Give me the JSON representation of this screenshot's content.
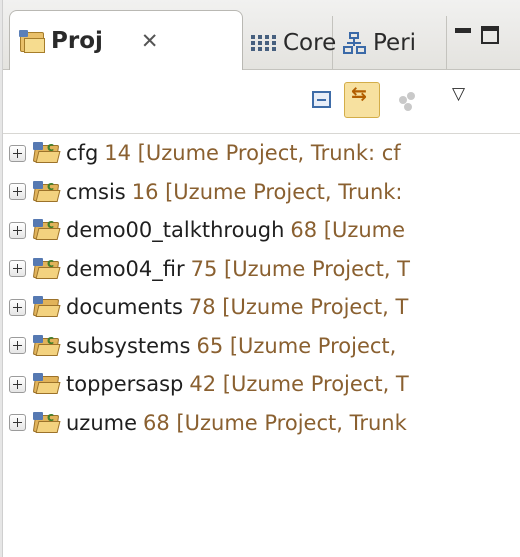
{
  "tabs": [
    {
      "label": "Proj",
      "close": "✕",
      "active": true
    },
    {
      "label": "Core",
      "active": false
    },
    {
      "label": "Peri",
      "active": false
    }
  ],
  "toolbar": {
    "buttons": [
      "collapse-all",
      "link-with-editor",
      "filter",
      "view-menu"
    ],
    "menu_glyph": "▽"
  },
  "tree": {
    "items": [
      {
        "name": "cfg",
        "decoration": "14 [Uzume Project, Trunk: cf",
        "icon": "project-folder-with-c-icon"
      },
      {
        "name": "cmsis",
        "decoration": "16 [Uzume Project, Trunk:",
        "icon": "project-folder-with-c-icon"
      },
      {
        "name": "demo00_talkthrough",
        "decoration": "68 [Uzume",
        "icon": "project-folder-with-c-icon"
      },
      {
        "name": "demo04_fir",
        "decoration": "75 [Uzume Project, T",
        "icon": "project-folder-with-c-icon"
      },
      {
        "name": "documents",
        "decoration": "78 [Uzume Project, T",
        "icon": "project-folder-icon"
      },
      {
        "name": "subsystems",
        "decoration": "65 [Uzume Project,",
        "icon": "project-folder-with-c-icon"
      },
      {
        "name": "toppersasp",
        "decoration": "42 [Uzume Project, T",
        "icon": "project-folder-icon"
      },
      {
        "name": "uzume",
        "decoration": "68 [Uzume Project, Trunk",
        "icon": "project-folder-with-c-icon"
      }
    ]
  },
  "colors": {
    "decoration": "#8a6030",
    "active_tab_bg": "#ffffff",
    "link_button_bg": "#f7e1a0"
  }
}
